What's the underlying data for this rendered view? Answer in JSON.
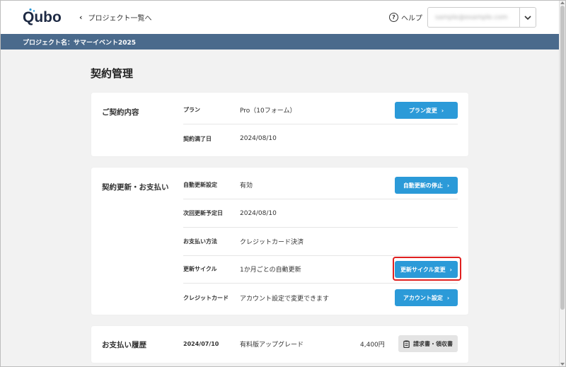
{
  "header": {
    "logo_text": "Qubo",
    "back_link": "プロジェクト一覧へ",
    "help": "ヘルプ",
    "account_email": "sample@example.com"
  },
  "project_bar": "プロジェクト名：サマーイベント2025",
  "page_title": "契約管理",
  "contract": {
    "title": "ご契約内容",
    "rows": [
      {
        "label": "プラン",
        "value": "Pro（10フォーム）",
        "button": "プラン変更"
      },
      {
        "label": "契約満了日",
        "value": "2024/08/10"
      }
    ]
  },
  "renewal": {
    "title": "契約更新・お支払い",
    "rows": [
      {
        "label": "自動更新設定",
        "value": "有効",
        "button": "自動更新の停止"
      },
      {
        "label": "次回更新予定日",
        "value": "2024/08/10"
      },
      {
        "label": "お支払い方法",
        "value": "クレジットカード決済"
      },
      {
        "label": "更新サイクル",
        "value": "1か月ごとの自動更新",
        "button": "更新サイクル変更"
      },
      {
        "label": "クレジットカード",
        "value": "アカウント設定で変更できます",
        "button": "アカウント設定"
      }
    ]
  },
  "history": {
    "title": "お支払い履歴",
    "rows": [
      {
        "date": "2024/07/10",
        "description": "有料版アップグレード",
        "amount": "4,400円",
        "button": "請求書・領収書"
      }
    ]
  },
  "colors": {
    "primary": "#2b9ad8",
    "project_bar": "#4a6a8c",
    "highlight": "#e02020"
  }
}
